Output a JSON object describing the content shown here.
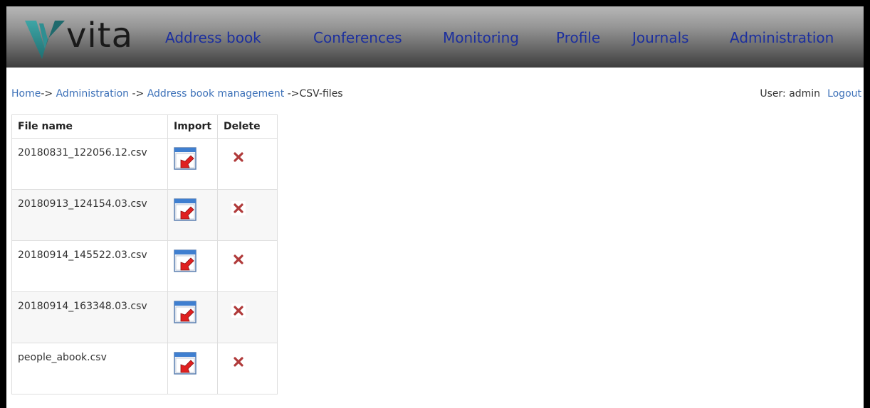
{
  "logo": {
    "text": "vita"
  },
  "nav": {
    "items": [
      {
        "label": "Address book"
      },
      {
        "label": "Conferences"
      },
      {
        "label": "Monitoring"
      },
      {
        "label": "Profile"
      },
      {
        "label": "Journals"
      },
      {
        "label": "Administration"
      }
    ]
  },
  "breadcrumb": {
    "home": "Home",
    "sep1": "-> ",
    "admin": "Administration",
    "sep2": " -> ",
    "abook": "Address book management",
    "sep3": " ->",
    "current": "CSV-files"
  },
  "user": {
    "label": "User: admin",
    "logout": "Logout"
  },
  "table": {
    "headers": {
      "file_name": "File name",
      "import": "Import",
      "delete": "Delete"
    },
    "rows": [
      {
        "file_name": "20180831_122056.12.csv"
      },
      {
        "file_name": "20180913_124154.03.csv"
      },
      {
        "file_name": "20180914_145522.03.csv"
      },
      {
        "file_name": "20180914_163348.03.csv"
      },
      {
        "file_name": "people_abook.csv"
      }
    ]
  },
  "colors": {
    "nav_link": "#1c2f9e",
    "breadcrumb_link": "#3d71b8",
    "delete_icon": "#b03a3a",
    "import_icon_red": "#e02020",
    "logo_teal": "#2a8a8a"
  },
  "icons": {
    "logo_mark": "v-mark-icon",
    "import": "import-icon",
    "delete": "delete-x-icon"
  }
}
